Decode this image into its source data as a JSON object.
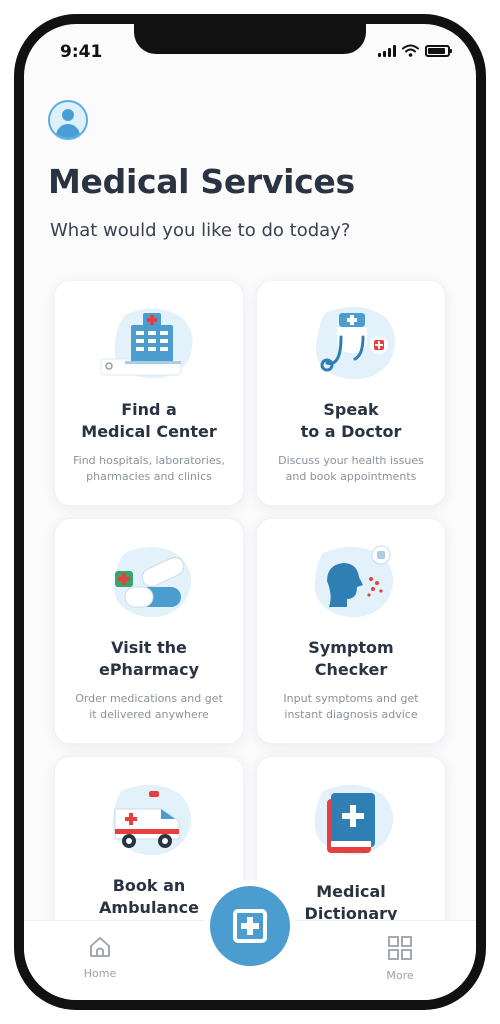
{
  "status": {
    "time": "9:41"
  },
  "header": {
    "title": "Medical Services",
    "subtitle": "What would you like to do today?"
  },
  "cards": [
    {
      "title_line1": "Find a",
      "title_line2": "Medical Center",
      "desc_line1": "Find hospitals, laboratories,",
      "desc_line2": "pharmacies and clinics",
      "icon": "hospital-icon"
    },
    {
      "title_line1": "Speak",
      "title_line2": "to a Doctor",
      "desc_line1": "Discuss your health issues",
      "desc_line2": "and book appointments",
      "icon": "doctor-icon"
    },
    {
      "title_line1": "Visit the",
      "title_line2": "ePharmacy",
      "desc_line1": "Order medications and get",
      "desc_line2": "it delivered anywhere",
      "icon": "pills-icon"
    },
    {
      "title_line1": "Symptom",
      "title_line2": "Checker",
      "desc_line1": "Input symptoms and get",
      "desc_line2": "instant diagnosis advice",
      "icon": "sneeze-icon"
    },
    {
      "title_line1": "Book an",
      "title_line2": "Ambulance",
      "icon": "ambulance-icon"
    },
    {
      "title_line1": "Medical",
      "title_line2": "Dictionary",
      "icon": "book-icon"
    }
  ],
  "tabbar": {
    "home_label": "Home",
    "more_label": "More"
  },
  "colors": {
    "accent": "#4b9ccf",
    "red": "#e5403f",
    "blob": "#e3f1fb",
    "title": "#2a3342"
  }
}
